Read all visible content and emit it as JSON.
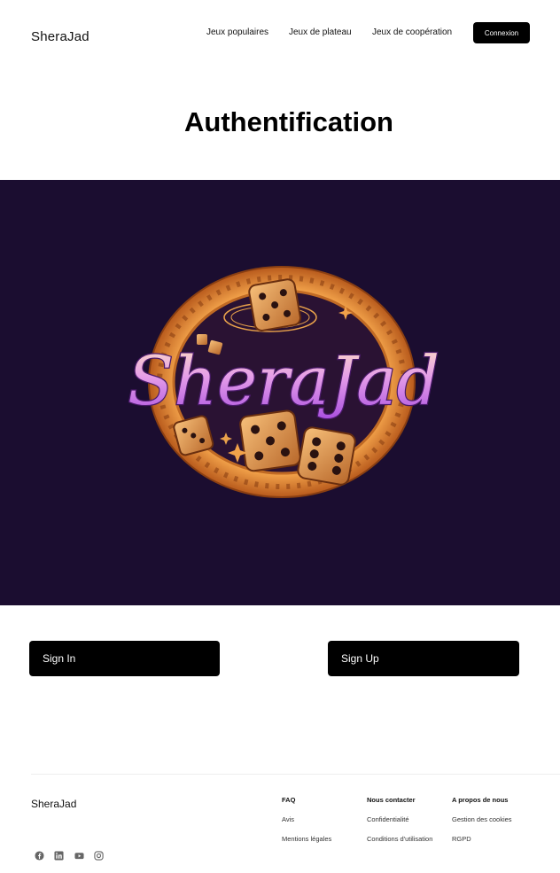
{
  "header": {
    "brand": "SheraJad",
    "nav": [
      "Jeux populaires",
      "Jeux de plateau",
      "Jeux de coopération"
    ],
    "login_button": "Connexion"
  },
  "page": {
    "title": "Authentification"
  },
  "hero": {
    "logo_text": "SheraJad",
    "bg_color": "#1b0d30"
  },
  "auth": {
    "sign_in": "Sign In",
    "sign_up": "Sign Up"
  },
  "footer": {
    "brand": "SheraJad",
    "columns": [
      {
        "title": "FAQ",
        "links": [
          "Avis",
          "Mentions légales"
        ]
      },
      {
        "title": "Nous contacter",
        "links": [
          "Confidentialité",
          "Conditions d'utilisation"
        ]
      },
      {
        "title": "A propos de nous",
        "links": [
          "Gestion des cookies",
          "RGPD"
        ]
      }
    ],
    "social_icons": [
      "facebook-icon",
      "linkedin-icon",
      "youtube-icon",
      "instagram-icon"
    ]
  },
  "colors": {
    "accent": "#000000",
    "hero_bg": "#1b0d30",
    "logo_orange": "#e88a3a",
    "logo_purple": "#c06cf0"
  }
}
